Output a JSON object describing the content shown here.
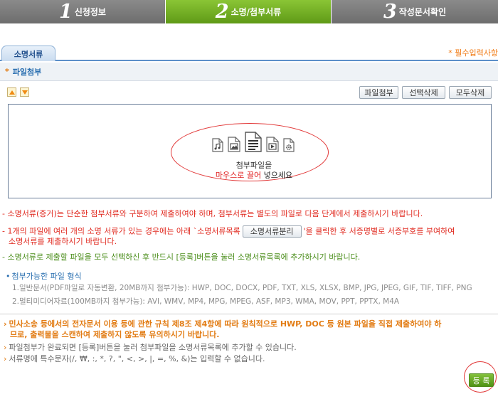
{
  "steps": [
    {
      "num": "1",
      "label": "신청정보"
    },
    {
      "num": "2",
      "label": "소명/첨부서류"
    },
    {
      "num": "3",
      "label": "작성문서확인"
    }
  ],
  "section": {
    "tab_label": "소명서류",
    "required_note": "* 필수입력사항"
  },
  "attach": {
    "star": "*",
    "title": "파일첨부"
  },
  "toolbar": {
    "attach_label": "파일첨부",
    "delete_selected_label": "선택삭제",
    "delete_all_label": "모두삭제"
  },
  "drop_area": {
    "line1": "첨부파일을",
    "line2_red": "마우스로 끌어",
    "line2_rest": " 넣으세요"
  },
  "notices": {
    "n1": "- 소명서류(증거)는 단순한 첨부서류와 구분하여 제출하여야 하며, 첨부서류는 별도의 파일로 다음 단계에서 제출하시기 바랍니다.",
    "n2_before": "- 1개의 파일에 여러 개의 소명 서류가 있는 경우에는 아래 `소명서류목록",
    "n2_button": "소명서류분리",
    "n2_after": "'을 클릭한 후 서증명별로 서증부호를 부여하여",
    "n2_line2": "소명서류를 제출하시기 바랍니다.",
    "n3": "- 소명서류로 제출할 파일을 모두 선택하신 후 반드시 [등록]버튼을 눌러 소명서류목록에 추가하시기 바랍니다."
  },
  "formats": {
    "title": "첨부가능한 파일 형식",
    "line1": "1.일반문서(PDF파일로 자동변환, 20MB까지 첨부가능): HWP, DOC, DOCX, PDF, TXT, XLS, XLSX, BMP, JPG, JPEG, GIF, TIF, TIFF, PNG",
    "line2": "2.멀티미디어자료(100MB까지 첨부가능): AVI, WMV, MP4, MPG, MPEG, ASF, MP3, WMA, MOV, PPT, PPTX, M4A"
  },
  "instructions": {
    "i1_line1": "민사소송 등에서의 전자문서 이용 등에 관한 규칙 제8조 제4항에 따라 원칙적으로 HWP, DOC 등 원본 파일을 직접 제출하여야 하",
    "i1_line2": "므로, 출력물을 스캔하여 제출하지 않도록 유의하시기 바랍니다.",
    "i2": "파일첨부가 완료되면 [등록]버튼을 눌러 첨부파일을 소명서류목록에 추가할 수 있습니다.",
    "i3": "서류명에 특수문자(/, ₩, :, *, ?, \", <, >, |, =, %, &)는 입력할 수 없습니다."
  },
  "register_label": "등 록",
  "colors": {
    "active_step": "#6fab22",
    "inactive_step": "#7c7c7c",
    "accent_blue": "#2a6fb0",
    "warning_red": "#e0281e",
    "notice_orange": "#e27c14"
  }
}
